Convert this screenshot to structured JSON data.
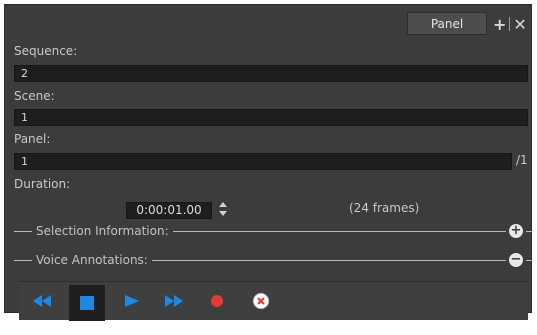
{
  "panel_tab": {
    "label": "Panel"
  },
  "fields": {
    "sequence": {
      "label": "Sequence:",
      "value": "2"
    },
    "scene": {
      "label": "Scene:",
      "value": "1"
    },
    "panel": {
      "label": "Panel:",
      "value": "1",
      "suffix": "/1"
    },
    "duration": {
      "label": "Duration:",
      "value": "0:00:01.00",
      "frames": "(24 frames)"
    }
  },
  "sections": {
    "selection_info": "Selection Information:",
    "voice_annotations": "Voice Annotations:"
  },
  "transport_buttons": [
    "rewind-icon",
    "stop-icon",
    "play-icon",
    "fast-forward-icon",
    "record-icon",
    "delete-recording-icon"
  ],
  "colors": {
    "panel_bg": "#3c3c3c",
    "field_bg": "#1e1e1e",
    "accent_blue": "#1e88e5",
    "record_red": "#e53935"
  }
}
